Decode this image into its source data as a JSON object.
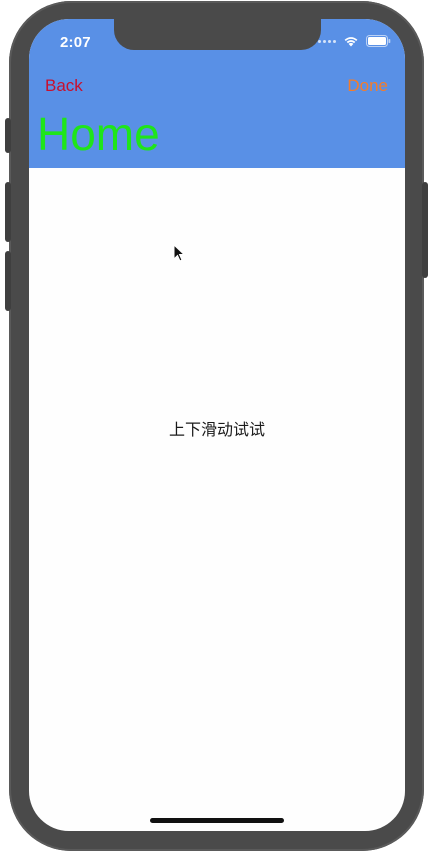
{
  "status_bar": {
    "time": "2:07",
    "icons": [
      "signal-dots-icon",
      "wifi-icon",
      "battery-icon"
    ]
  },
  "navbar": {
    "back_label": "Back",
    "done_label": "Done",
    "title": "Home",
    "colors": {
      "background": "#5990e6",
      "back": "#c8102e",
      "done": "#f47c2b",
      "title": "#1fe51a"
    }
  },
  "content": {
    "message": "上下滑动试试"
  }
}
